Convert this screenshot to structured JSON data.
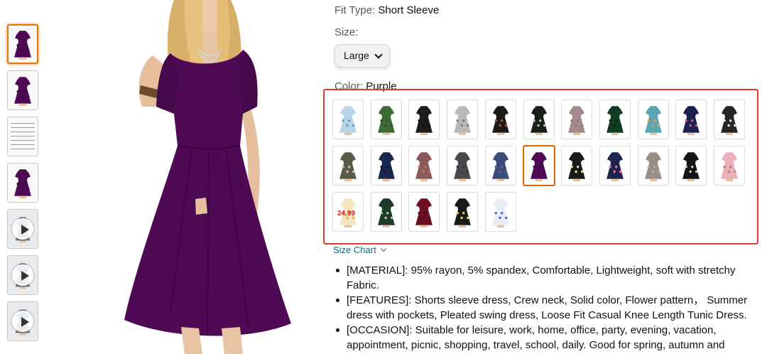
{
  "thumbnails": [
    {
      "name": "thumbnail-front",
      "type": "image",
      "selected": true
    },
    {
      "name": "thumbnail-side",
      "type": "image"
    },
    {
      "name": "thumbnail-size-chart",
      "type": "image"
    },
    {
      "name": "thumbnail-back",
      "type": "image"
    },
    {
      "name": "thumbnail-video-1",
      "type": "video"
    },
    {
      "name": "thumbnail-video-2",
      "type": "video"
    },
    {
      "name": "thumbnail-video-3",
      "type": "video"
    }
  ],
  "product": {
    "fit_label": "Fit Type:",
    "fit_value": "Short Sleeve",
    "size_label": "Size:",
    "size_value": "Large",
    "color_label": "Color:",
    "color_value": "Purple",
    "size_chart_link": "Size Chart",
    "swatch_price_tag": "24.99",
    "bullets": [
      "[MATERIAL]: 95% rayon, 5% spandex, Comfortable, Lightweight, soft with stretchy Fabric.",
      "[FEATURES]: Shorts sleeve dress, Crew neck, Solid color, Flower pattern， Summer dress with pockets, Pleated swing dress, Loose Fit Casual Knee Length Tunic Dress.",
      "[OCCASION]: Suitable for leisure, work, home, office, party, evening, vacation, appointment, picnic, shopping, travel, school, daily. Good for spring, autumn and"
    ]
  },
  "colors": {
    "accent": "#e77600",
    "link": "#007185",
    "highlight_box": "#e53935",
    "dress_purple": "#4f0a55"
  },
  "swatches": [
    {
      "name": "swatch-light-blue-floral",
      "colors": [
        "#b8d4e8",
        "#6b9cc4"
      ]
    },
    {
      "name": "swatch-green",
      "colors": [
        "#3c6b36",
        "#2c5028"
      ]
    },
    {
      "name": "swatch-black",
      "colors": [
        "#1c1c1c",
        "#111111"
      ]
    },
    {
      "name": "swatch-grey-paisley",
      "colors": [
        "#b9b9b9",
        "#7d7d7d"
      ]
    },
    {
      "name": "swatch-black-red-floral",
      "colors": [
        "#1e1a1a",
        "#c05030"
      ]
    },
    {
      "name": "swatch-black-leaf-print",
      "colors": [
        "#1b1f1a",
        "#b8c0a8"
      ]
    },
    {
      "name": "swatch-mauve-grey",
      "colors": [
        "#a48a8c",
        "#8a7476"
      ]
    },
    {
      "name": "swatch-dark-green",
      "colors": [
        "#123c26",
        "#0b2b1a"
      ]
    },
    {
      "name": "swatch-teal-floral",
      "colors": [
        "#5aa6b4",
        "#d6a05a"
      ]
    },
    {
      "name": "swatch-navy-floral",
      "colors": [
        "#1c2150",
        "#d05a8a"
      ]
    },
    {
      "name": "swatch-black-white-floral",
      "colors": [
        "#262626",
        "#e0e0e0"
      ]
    },
    {
      "name": "swatch-olive-floral",
      "colors": [
        "#5a5a4a",
        "#c8c0b0"
      ]
    },
    {
      "name": "swatch-navy",
      "colors": [
        "#1a2850",
        "#121c3c"
      ]
    },
    {
      "name": "swatch-rust-floral",
      "colors": [
        "#8a5a58",
        "#c07060"
      ]
    },
    {
      "name": "swatch-charcoal",
      "colors": [
        "#4a4a4e",
        "#3a3a3e"
      ]
    },
    {
      "name": "swatch-blue-stripe",
      "colors": [
        "#3c4a78",
        "#5a6a98"
      ]
    },
    {
      "name": "swatch-purple",
      "colors": [
        "#4f0a55",
        "#3e0843"
      ],
      "selected": true
    },
    {
      "name": "swatch-black-daisy",
      "colors": [
        "#1a1a1a",
        "#e8e0a0"
      ]
    },
    {
      "name": "swatch-navy-pink-floral",
      "colors": [
        "#1e2450",
        "#e07aa0"
      ]
    },
    {
      "name": "swatch-taupe-floral",
      "colors": [
        "#9a8e8a",
        "#c8a8a0"
      ]
    },
    {
      "name": "swatch-black-stripe",
      "colors": [
        "#151515",
        "#d8d0c0"
      ]
    },
    {
      "name": "swatch-pink-stripe",
      "colors": [
        "#e8b0b8",
        "#c07880"
      ]
    },
    {
      "name": "swatch-sunflower",
      "colors": [
        "#f4e6c0",
        "#e0b020"
      ]
    },
    {
      "name": "swatch-green-leaf",
      "colors": [
        "#1e3a2a",
        "#a8d0b0"
      ]
    },
    {
      "name": "swatch-burgundy",
      "colors": [
        "#6a1020",
        "#500a18"
      ]
    },
    {
      "name": "swatch-black-lemon",
      "colors": [
        "#1a1a1a",
        "#e8d840"
      ]
    },
    {
      "name": "swatch-blue-white-floral",
      "colors": [
        "#e8eef8",
        "#3a6ac8"
      ]
    }
  ]
}
